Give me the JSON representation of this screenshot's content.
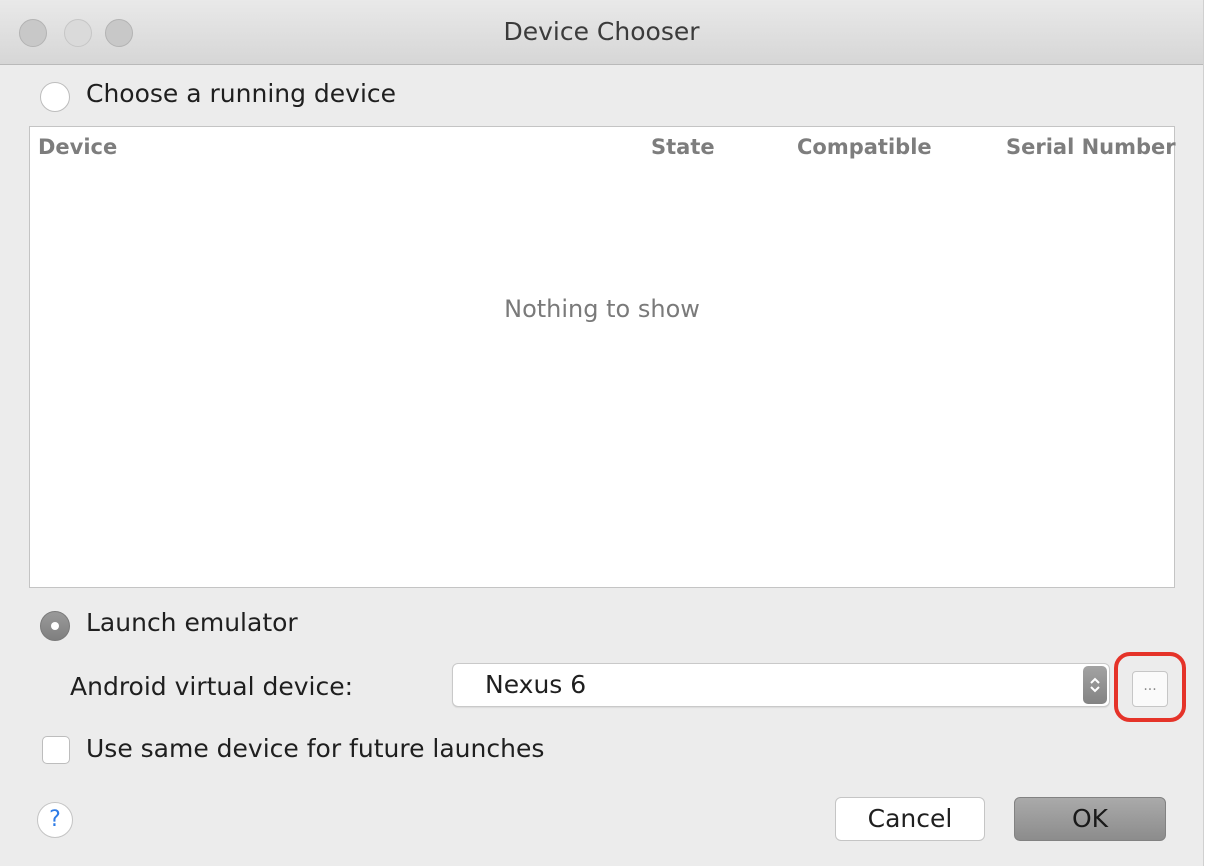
{
  "window": {
    "title": "Device Chooser"
  },
  "running": {
    "label": "Choose a running device",
    "columns": [
      "Device",
      "State",
      "Compatible",
      "Serial Number"
    ],
    "empty_text": "Nothing to show"
  },
  "emulator": {
    "label": "Launch emulator",
    "avd_label": "Android virtual device:",
    "avd_value": "Nexus 6",
    "browse_label": "..."
  },
  "options": {
    "same_device_label": "Use same device for future launches"
  },
  "footer": {
    "help_label": "?",
    "cancel_label": "Cancel",
    "ok_label": "OK"
  },
  "colors": {
    "highlight": "#e53329",
    "help_blue": "#2d7be6"
  }
}
